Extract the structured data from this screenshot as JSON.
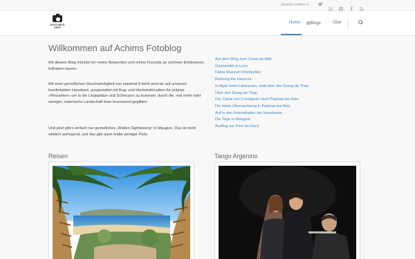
{
  "topbar": {
    "language": "Sprache wählen",
    "social_icons": [
      "twitter-icon",
      "linkedin-icon",
      "instagram-icon",
      "facebook-icon",
      "rss-icon"
    ]
  },
  "logo": {
    "line1": "AVAILABLE",
    "line2": "LIGHT"
  },
  "nav": {
    "home": "Home",
    "blogs": "Blogs",
    "about": "Über",
    "blogs_icon": "▤"
  },
  "page": {
    "title": "Willkommen auf Achims Fotoblog",
    "paragraphs": [
      "Mit diesem Blog möchte ich meine Bekannten und meine Freunde an schönen Erlebnissen teilhaben lassen.",
      "Mit einer gemütlichen Geschwindigkeit von maximal 8 km/h sind wir auf unserem komfortablen Hausboot, ausgestattet mit Bug- und Heckstrahlrudern für präzise »Pirouetten« um in die Liegeplätze und Schleusen zu kommen, durch die, mal mehr oder weniger, malerische Landschaft leise brummend geglitten.",
      "Und jetzt gibt's einfach nur gemütliches „Wellen-Sightseeing“ in Mauguio. Das ist nicht wirklich aufregend, und das gibt dann leider weniger Picts."
    ]
  },
  "links": [
    "Auf dem Weg zum Canal du Midi",
    "Gestrandet in Lyon",
    "Fabre Museum Montpellier",
    "Running the Hausoot",
    "In Agde beim Libanesen, statt über den Étang de Thau",
    "Über den Étang de Thau",
    "Der Canal von Frontignan nach Paalvas-les-flots",
    "Die letzte Übernachtung in Paalvas-les-flots",
    "Auf in den Heimathafen der Hausboote",
    "Die Tage in Mauguio",
    "Ausflug zur Pont du Gard"
  ],
  "sections": {
    "left": "Reisen",
    "right": "Tango Argenino"
  },
  "colors": {
    "accent": "#3f87c3",
    "text": "#666666",
    "background": "#f8f8f8"
  }
}
